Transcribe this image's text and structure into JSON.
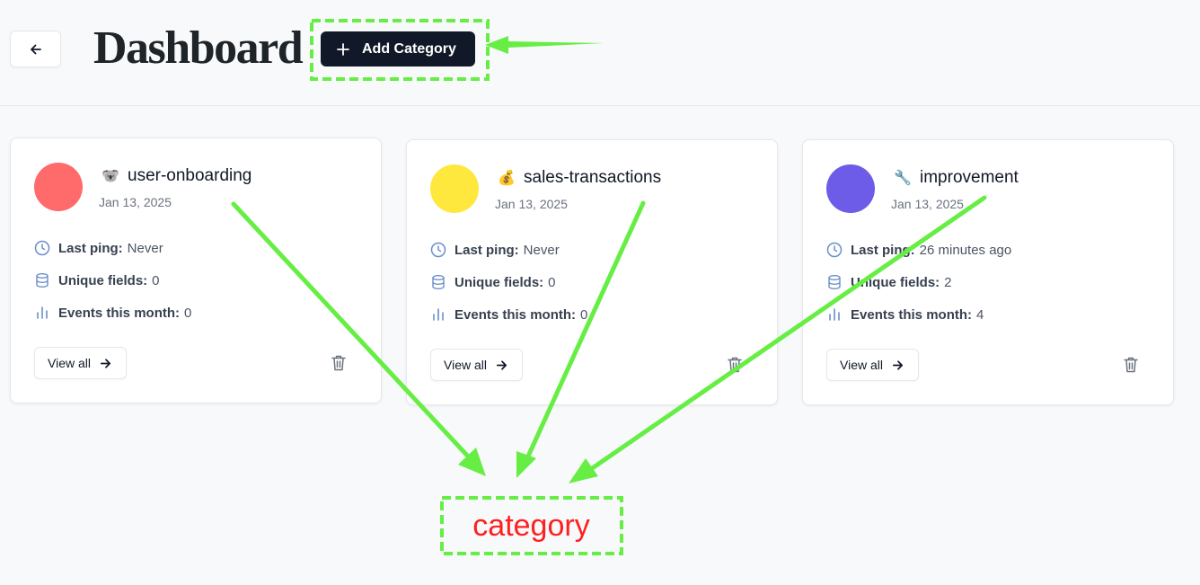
{
  "header": {
    "title": "Dashboard",
    "add_button_label": "Add Category",
    "back_icon": "arrow-left-icon",
    "add_icon": "plus-icon"
  },
  "categories": [
    {
      "name": "user-onboarding",
      "emoji": "🐨",
      "color": "#ff6b6b",
      "date": "Jan 13, 2025",
      "last_ping_label": "Last ping:",
      "last_ping": "Never",
      "unique_fields_label": "Unique fields:",
      "unique_fields": "0",
      "events_label": "Events this month:",
      "events": "0",
      "view_all_label": "View all"
    },
    {
      "name": "sales-transactions",
      "emoji": "💰",
      "color": "#ffe83d",
      "date": "Jan 13, 2025",
      "last_ping_label": "Last ping:",
      "last_ping": "Never",
      "unique_fields_label": "Unique fields:",
      "unique_fields": "0",
      "events_label": "Events this month:",
      "events": "0",
      "view_all_label": "View all"
    },
    {
      "name": "improvement",
      "emoji": "🔧",
      "color": "#6c5ce7",
      "date": "Jan 13, 2025",
      "last_ping_label": "Last ping:",
      "last_ping": "26 minutes ago",
      "unique_fields_label": "Unique fields:",
      "unique_fields": "2",
      "events_label": "Events this month:",
      "events": "4",
      "view_all_label": "View all"
    }
  ],
  "annotation": {
    "label": "category",
    "highlight_color": "#66ee44",
    "label_color": "#ff1f1f"
  }
}
